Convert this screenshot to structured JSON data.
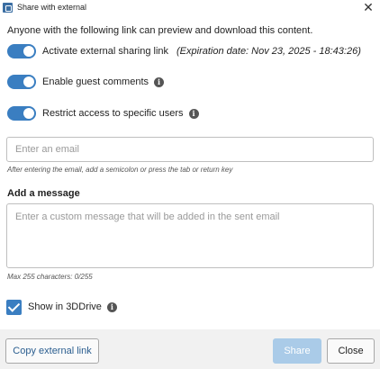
{
  "window": {
    "title": "Share with external",
    "close_icon": "close-icon"
  },
  "intro_text": "Anyone with the following link can preview and download this content.",
  "toggles": [
    {
      "label": "Activate external sharing link",
      "on": true,
      "extra": "(Expiration date: Nov 23, 2025 - 18:43:26)"
    },
    {
      "label": "Enable guest comments",
      "on": true,
      "info": "info-icon"
    },
    {
      "label": "Restrict access to specific users",
      "on": true,
      "info": "info-icon"
    }
  ],
  "email": {
    "placeholder": "Enter an email",
    "value": "",
    "hint": "After entering the email, add a semicolon or press the tab or return key"
  },
  "message": {
    "title": "Add a message",
    "placeholder": "Enter a custom message that will be added in the sent email",
    "value": "",
    "counter": "Max 255 characters: 0/255"
  },
  "show_in_3ddrive": {
    "label": "Show in 3DDrive",
    "checked": true
  },
  "footer": {
    "copy_label": "Copy external link",
    "share_label": "Share",
    "close_label": "Close"
  },
  "colors": {
    "accent": "#3a7ec1",
    "share_disabled": "#aacbe8",
    "footer_bg": "#f1f1f1"
  }
}
